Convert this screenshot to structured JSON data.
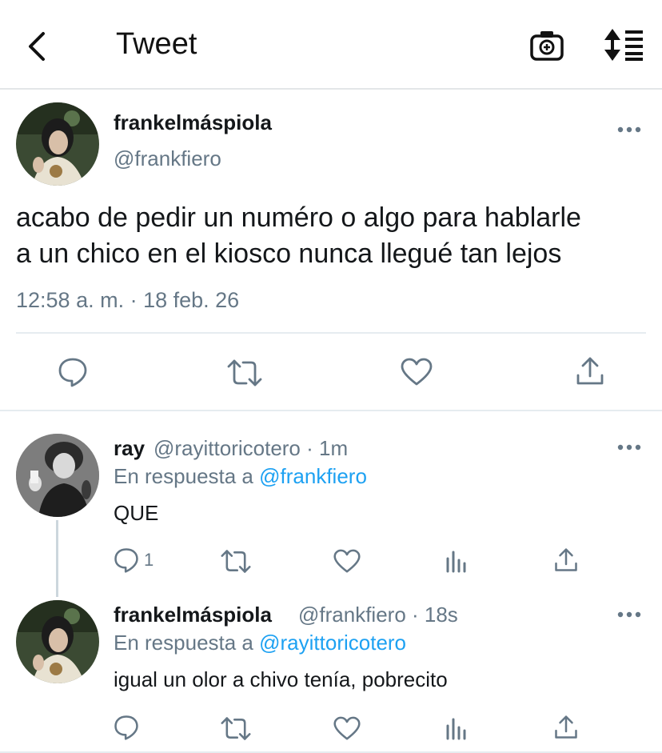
{
  "header": {
    "title": "Tweet"
  },
  "main_tweet": {
    "name": "frankelmáspiola",
    "handle": "@frankfiero",
    "text_line1": "acabo de pedir un numéro o algo para hablarle",
    "text_line2": "a un chico en el kiosco nunca llegué tan lejos",
    "timestamp": "12:58 a. m. · 18 feb. 26"
  },
  "replies": [
    {
      "name": "ray",
      "handle_time": "@rayittoricotero · 1m",
      "reply_prefix": "En respuesta a ",
      "reply_mention": "@frankfiero",
      "text": "QUE",
      "reply_count": "1"
    },
    {
      "name": "frankelmáspiola",
      "handle_time": "@frankfiero · 18s",
      "reply_prefix": "En respuesta a ",
      "reply_mention": "@rayittoricotero",
      "text": "igual un olor a chivo tenía, pobrecito",
      "reply_count": ""
    }
  ],
  "colors": {
    "accent": "#1da1f2",
    "secondary_text": "#657786",
    "icon": "#657786"
  }
}
